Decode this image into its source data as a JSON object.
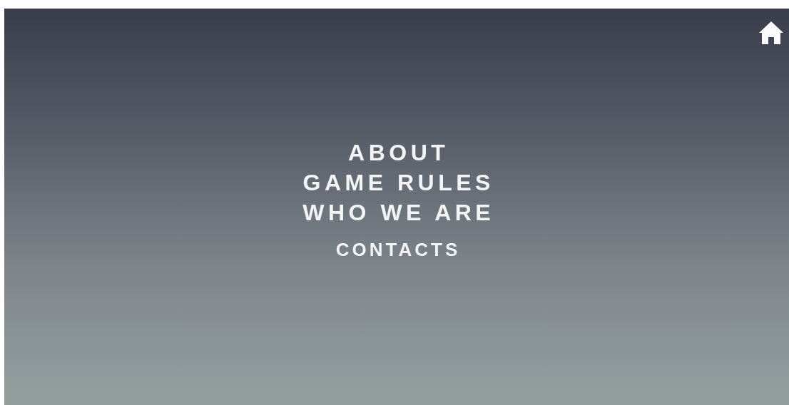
{
  "menu": [
    {
      "label": "ABOUT",
      "kind": "main"
    },
    {
      "label": "GAME RULES",
      "kind": "main"
    },
    {
      "label": "WHO WE ARE",
      "kind": "main"
    },
    {
      "label": "CONTACTS",
      "kind": "minor"
    }
  ]
}
